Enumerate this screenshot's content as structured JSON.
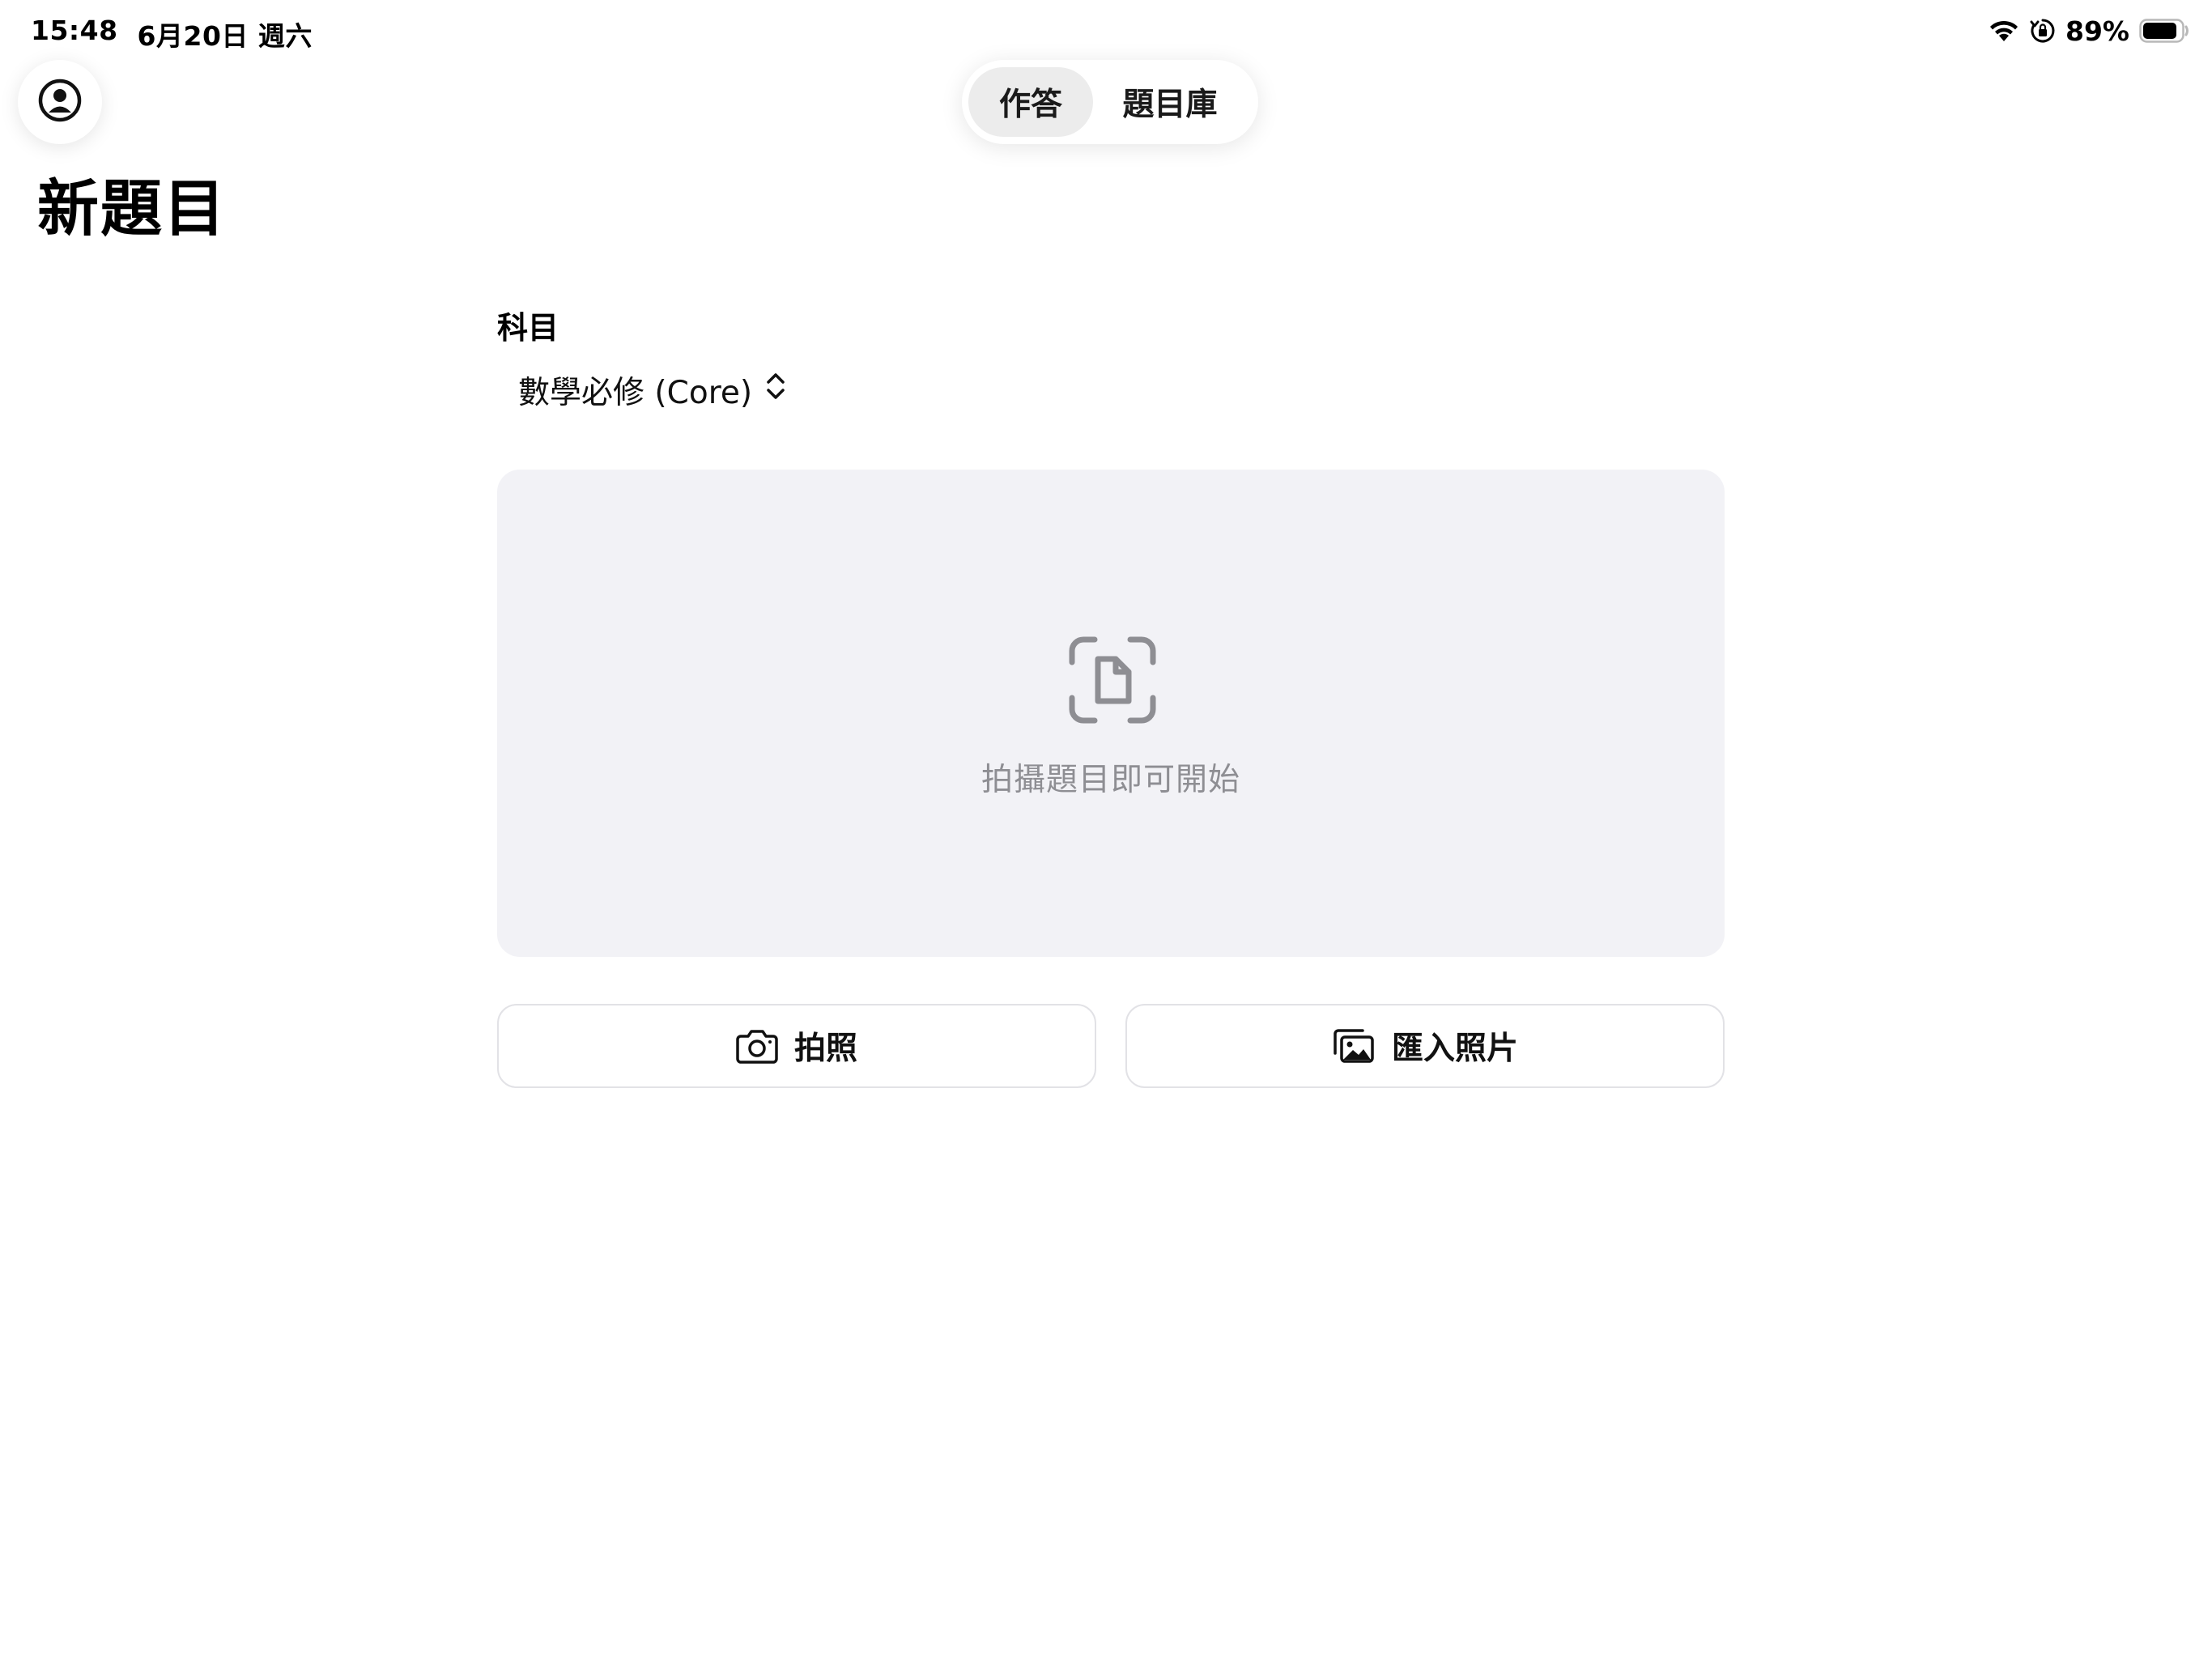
{
  "status_bar": {
    "time": "15:48",
    "date": "6月20日 週六",
    "battery_percent": "89%",
    "battery_level": 0.89,
    "icons": [
      "wifi-icon",
      "orientation-lock-icon",
      "battery-icon"
    ]
  },
  "header": {
    "profile_icon": "person-circle-icon",
    "tabs": [
      {
        "label": "作答",
        "active": true
      },
      {
        "label": "題目庫",
        "active": false
      }
    ]
  },
  "page": {
    "title": "新題目"
  },
  "subject": {
    "label": "科目",
    "selected": "數學必修 (Core)",
    "icon": "chevron-up-down-icon"
  },
  "capture": {
    "icon": "document-scan-icon",
    "hint": "拍攝題目即可開始",
    "background_color": "#f2f2f6",
    "hint_color": "#8e8e93"
  },
  "actions": {
    "take_photo": {
      "label": "拍照",
      "icon": "camera-icon"
    },
    "import_photo": {
      "label": "匯入照片",
      "icon": "photo-stack-icon"
    }
  }
}
